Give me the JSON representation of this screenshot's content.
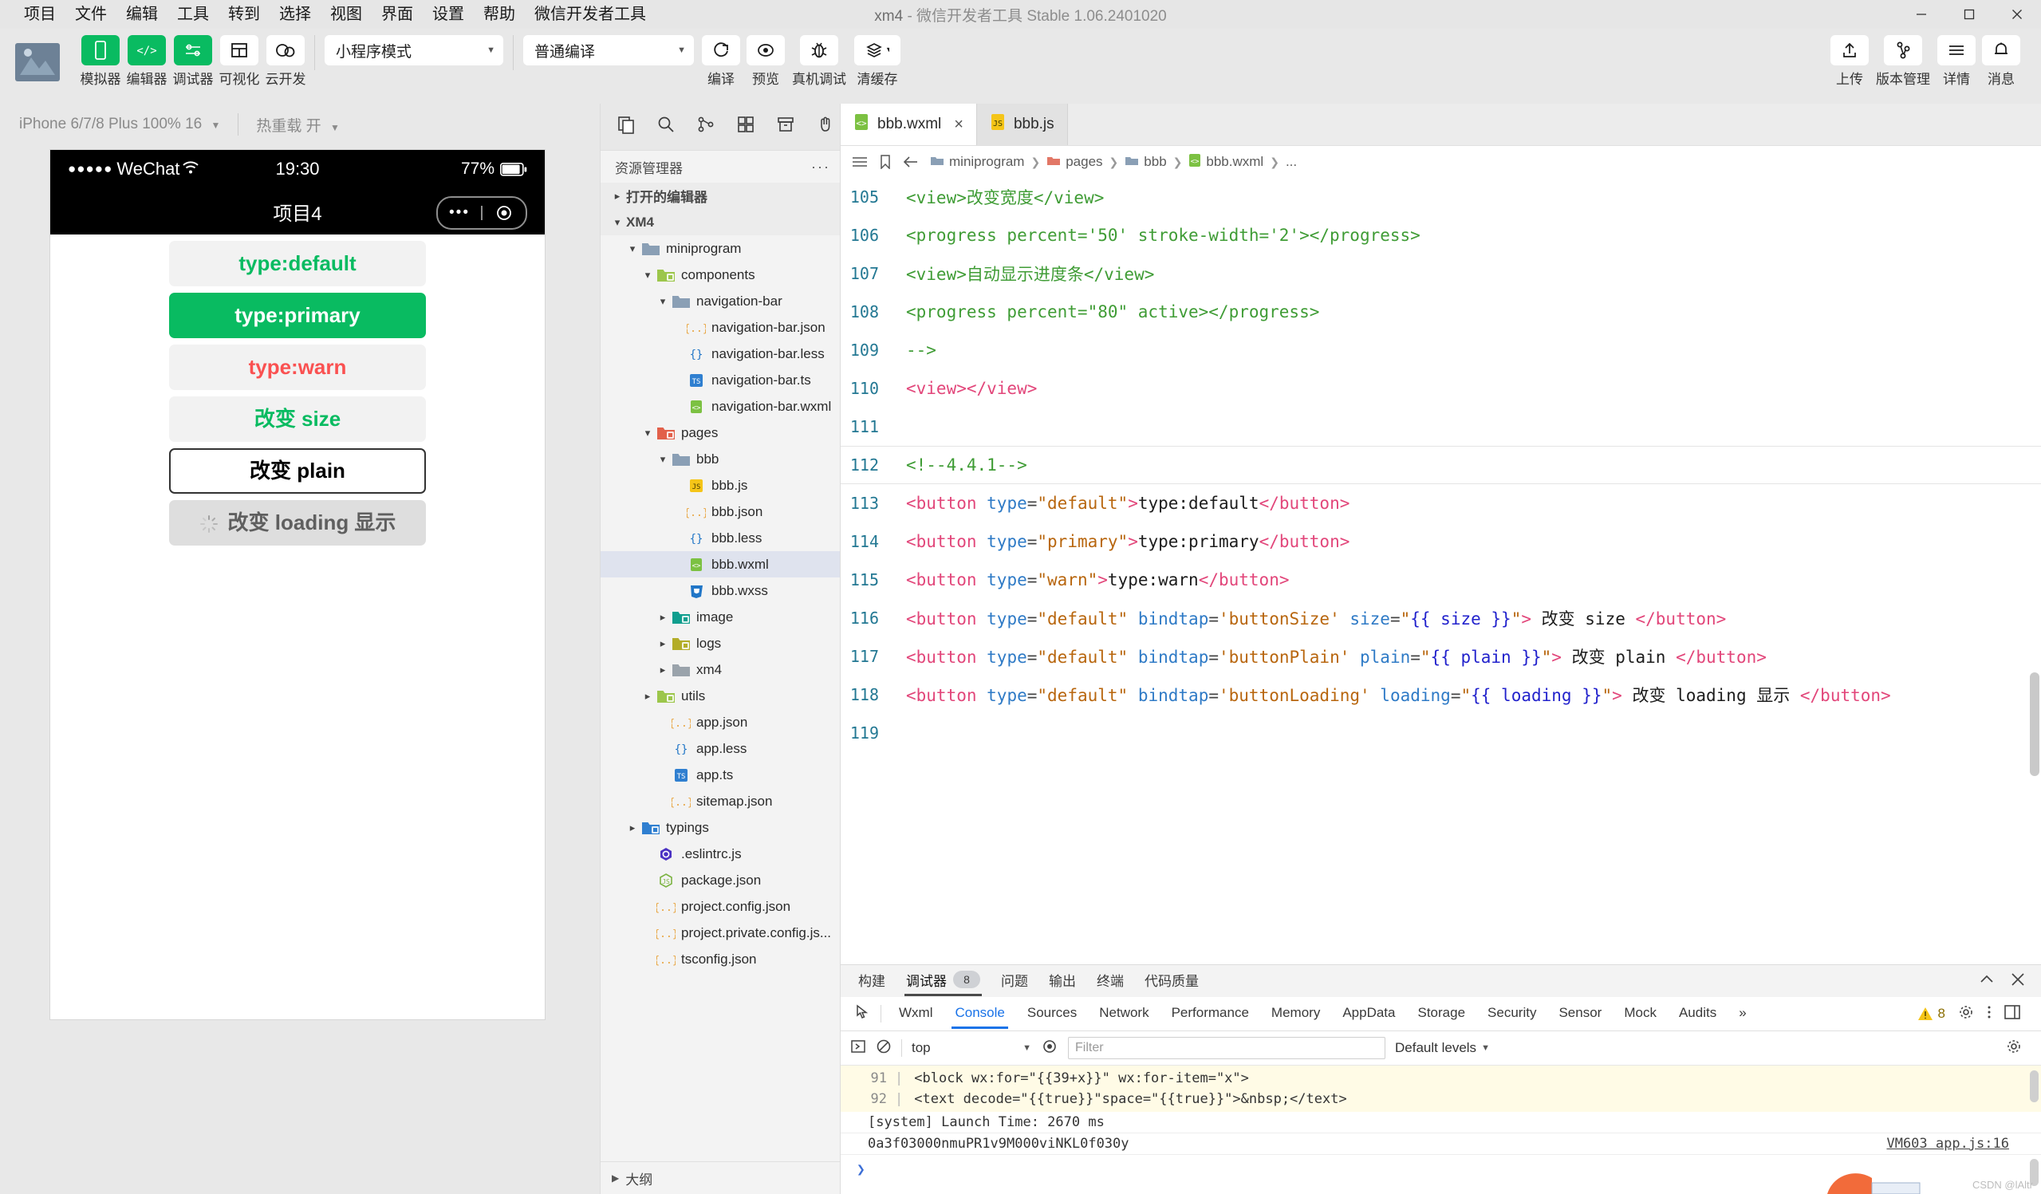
{
  "window": {
    "project": "xm4",
    "dash": "-",
    "app_name": "微信开发者工具",
    "version": "Stable 1.06.2401020",
    "minimize": "minimize-icon",
    "maximize": "maximize-icon",
    "close": "close-icon"
  },
  "menubar": {
    "items": [
      "项目",
      "文件",
      "编辑",
      "工具",
      "转到",
      "选择",
      "视图",
      "界面",
      "设置",
      "帮助",
      "微信开发者工具"
    ]
  },
  "toolbar": {
    "left_buttons": [
      {
        "label": "模拟器",
        "icon": "phone-icon",
        "active": true
      },
      {
        "label": "编辑器",
        "icon": "code-icon",
        "active": true
      },
      {
        "label": "调试器",
        "icon": "debugger-icon",
        "active": true
      },
      {
        "label": "可视化",
        "icon": "layout-icon",
        "active": false
      },
      {
        "label": "云开发",
        "icon": "cloud-icon",
        "active": false
      }
    ],
    "mode_select": "小程序模式",
    "compile_select": "普通编译",
    "action_buttons": [
      {
        "label": "编译",
        "icon": "refresh-icon"
      },
      {
        "label": "预览",
        "icon": "eye-icon"
      },
      {
        "label": "真机调试",
        "icon": "bug-icon"
      },
      {
        "label": "清缓存",
        "icon": "layers-icon"
      }
    ],
    "right_buttons": [
      {
        "label": "上传",
        "icon": "upload-icon"
      },
      {
        "label": "版本管理",
        "icon": "branch-icon"
      },
      {
        "label": "详情",
        "icon": "menu-icon"
      },
      {
        "label": "消息",
        "icon": "bell-icon"
      }
    ]
  },
  "simulator": {
    "device": "iPhone 6/7/8 Plus 100% 16",
    "hot_reload": "热重载 开",
    "status": {
      "dots": "●●●●●",
      "carrier": "WeChat",
      "time": "19:30",
      "battery": "77%"
    },
    "nav_title": "项目4",
    "capsule_dots": "•••",
    "buttons": [
      {
        "label": "type:default",
        "style": "default"
      },
      {
        "label": "type:primary",
        "style": "primary"
      },
      {
        "label": "type:warn",
        "style": "warn"
      },
      {
        "label": "改变 size",
        "style": "default"
      },
      {
        "label": "改变 plain",
        "style": "plain"
      },
      {
        "label": "改变 loading 显示",
        "style": "loading"
      }
    ]
  },
  "explorer": {
    "title": "资源管理器",
    "more": "ellipsis-icon",
    "outline": "大纲",
    "icons": [
      "copy-icon",
      "search-icon",
      "source-control-icon",
      "extensions-icon",
      "archive-icon",
      "hand-icon"
    ],
    "tree": [
      {
        "label": "打开的编辑器",
        "depth": 0,
        "type": "section",
        "arrow": "right"
      },
      {
        "label": "XM4",
        "depth": 0,
        "type": "section",
        "arrow": "down"
      },
      {
        "label": "miniprogram",
        "depth": 1,
        "type": "folder",
        "arrow": "down",
        "icon": "folder-blue"
      },
      {
        "label": "components",
        "depth": 2,
        "type": "folder",
        "arrow": "down",
        "icon": "folder-green"
      },
      {
        "label": "navigation-bar",
        "depth": 3,
        "type": "folder",
        "arrow": "down",
        "icon": "folder-blue"
      },
      {
        "label": "navigation-bar.json",
        "depth": 4,
        "type": "file",
        "icon": "json"
      },
      {
        "label": "navigation-bar.less",
        "depth": 4,
        "type": "file",
        "icon": "less"
      },
      {
        "label": "navigation-bar.ts",
        "depth": 4,
        "type": "file",
        "icon": "ts"
      },
      {
        "label": "navigation-bar.wxml",
        "depth": 4,
        "type": "file",
        "icon": "wxml"
      },
      {
        "label": "pages",
        "depth": 2,
        "type": "folder",
        "arrow": "down",
        "icon": "folder-red"
      },
      {
        "label": "bbb",
        "depth": 3,
        "type": "folder",
        "arrow": "down",
        "icon": "folder-blue"
      },
      {
        "label": "bbb.js",
        "depth": 4,
        "type": "file",
        "icon": "js"
      },
      {
        "label": "bbb.json",
        "depth": 4,
        "type": "file",
        "icon": "json"
      },
      {
        "label": "bbb.less",
        "depth": 4,
        "type": "file",
        "icon": "less"
      },
      {
        "label": "bbb.wxml",
        "depth": 4,
        "type": "file",
        "icon": "wxml",
        "selected": true
      },
      {
        "label": "bbb.wxss",
        "depth": 4,
        "type": "file",
        "icon": "wxss"
      },
      {
        "label": "image",
        "depth": 3,
        "type": "folder",
        "arrow": "right",
        "icon": "folder-teal"
      },
      {
        "label": "logs",
        "depth": 3,
        "type": "folder",
        "arrow": "right",
        "icon": "folder-olive"
      },
      {
        "label": "xm4",
        "depth": 3,
        "type": "folder",
        "arrow": "right",
        "icon": "folder-gray"
      },
      {
        "label": "utils",
        "depth": 2,
        "type": "folder",
        "arrow": "right",
        "icon": "folder-green"
      },
      {
        "label": "app.json",
        "depth": 3,
        "type": "file",
        "icon": "json"
      },
      {
        "label": "app.less",
        "depth": 3,
        "type": "file",
        "icon": "less"
      },
      {
        "label": "app.ts",
        "depth": 3,
        "type": "file",
        "icon": "ts"
      },
      {
        "label": "sitemap.json",
        "depth": 3,
        "type": "file",
        "icon": "json"
      },
      {
        "label": "typings",
        "depth": 1,
        "type": "folder",
        "arrow": "right",
        "icon": "folder-ts"
      },
      {
        "label": ".eslintrc.js",
        "depth": 2,
        "type": "file",
        "icon": "eslint"
      },
      {
        "label": "package.json",
        "depth": 2,
        "type": "file",
        "icon": "npm"
      },
      {
        "label": "project.config.json",
        "depth": 2,
        "type": "file",
        "icon": "json"
      },
      {
        "label": "project.private.config.js...",
        "depth": 2,
        "type": "file",
        "icon": "json"
      },
      {
        "label": "tsconfig.json",
        "depth": 2,
        "type": "file",
        "icon": "json"
      }
    ]
  },
  "editor": {
    "tabs": [
      {
        "label": "bbb.wxml",
        "icon": "wxml",
        "active": true,
        "close": "×"
      },
      {
        "label": "bbb.js",
        "icon": "js",
        "active": false
      }
    ],
    "breadcrumb": [
      "miniprogram",
      "pages",
      "bbb",
      "bbb.wxml",
      "..."
    ],
    "breadcrumb_icons": [
      "list-icon",
      "bookmark-icon",
      "back-arrow-icon"
    ],
    "lines": [
      {
        "num": "105",
        "segments": [
          {
            "t": "<view>",
            "c": "com"
          },
          {
            "t": "改变宽度",
            "c": "com"
          },
          {
            "t": "</view>",
            "c": "com"
          }
        ]
      },
      {
        "num": "106",
        "segments": [
          {
            "t": "<progress percent='50' stroke-width='2'></progress>",
            "c": "com"
          }
        ]
      },
      {
        "num": "107",
        "segments": [
          {
            "t": "<view>自动显示进度条</view>",
            "c": "com"
          }
        ]
      },
      {
        "num": "108",
        "segments": [
          {
            "t": "<progress percent=\"80\" active></progress>",
            "c": "com"
          }
        ]
      },
      {
        "num": "109",
        "segments": [
          {
            "t": "-->",
            "c": "com"
          }
        ]
      },
      {
        "num": "110",
        "segments": [
          {
            "t": "<view>",
            "c": "tag"
          },
          {
            "t": "</view>",
            "c": "tag"
          }
        ]
      },
      {
        "num": "111",
        "segments": []
      },
      {
        "num": "112",
        "hl": true,
        "segments": [
          {
            "t": "<!--4.4.1-->",
            "c": "com"
          }
        ]
      },
      {
        "num": "113",
        "segments": [
          {
            "t": "<button ",
            "c": "tag"
          },
          {
            "t": "type",
            "c": "attr"
          },
          {
            "t": "=",
            "c": "gray"
          },
          {
            "t": "\"default\"",
            "c": "str"
          },
          {
            "t": ">",
            "c": "tag"
          },
          {
            "t": "type:default",
            "c": "txt"
          },
          {
            "t": "</button>",
            "c": "tag"
          }
        ]
      },
      {
        "num": "114",
        "segments": [
          {
            "t": "<button ",
            "c": "tag"
          },
          {
            "t": "type",
            "c": "attr"
          },
          {
            "t": "=",
            "c": "gray"
          },
          {
            "t": "\"primary\"",
            "c": "str"
          },
          {
            "t": ">",
            "c": "tag"
          },
          {
            "t": "type:primary",
            "c": "txt"
          },
          {
            "t": "</button>",
            "c": "tag"
          }
        ]
      },
      {
        "num": "115",
        "segments": [
          {
            "t": "<button ",
            "c": "tag"
          },
          {
            "t": "type",
            "c": "attr"
          },
          {
            "t": "=",
            "c": "gray"
          },
          {
            "t": "\"warn\"",
            "c": "str"
          },
          {
            "t": ">",
            "c": "tag"
          },
          {
            "t": "type:warn",
            "c": "txt"
          },
          {
            "t": "</button>",
            "c": "tag"
          }
        ]
      },
      {
        "num": "116",
        "segments": [
          {
            "t": "<button ",
            "c": "tag"
          },
          {
            "t": "type",
            "c": "attr"
          },
          {
            "t": "=",
            "c": "gray"
          },
          {
            "t": "\"default\"",
            "c": "str"
          },
          {
            "t": " bindtap",
            "c": "attr"
          },
          {
            "t": "=",
            "c": "gray"
          },
          {
            "t": "'buttonSize'",
            "c": "str"
          },
          {
            "t": " size",
            "c": "attr"
          },
          {
            "t": "=",
            "c": "gray"
          },
          {
            "t": "\"",
            "c": "str"
          },
          {
            "t": "{{ size }}",
            "c": "mus"
          },
          {
            "t": "\"",
            "c": "str"
          },
          {
            "t": "> ",
            "c": "tag"
          },
          {
            "t": "改变 size ",
            "c": "txt"
          },
          {
            "t": "</button>",
            "c": "tag"
          }
        ]
      },
      {
        "num": "117",
        "segments": [
          {
            "t": "<button ",
            "c": "tag"
          },
          {
            "t": "type",
            "c": "attr"
          },
          {
            "t": "=",
            "c": "gray"
          },
          {
            "t": "\"default\"",
            "c": "str"
          },
          {
            "t": " bindtap",
            "c": "attr"
          },
          {
            "t": "=",
            "c": "gray"
          },
          {
            "t": "'buttonPlain'",
            "c": "str"
          },
          {
            "t": " plain",
            "c": "attr"
          },
          {
            "t": "=",
            "c": "gray"
          },
          {
            "t": "\"",
            "c": "str"
          },
          {
            "t": "{{ plain }}",
            "c": "mus"
          },
          {
            "t": "\"",
            "c": "str"
          },
          {
            "t": "> ",
            "c": "tag"
          },
          {
            "t": "改变 plain ",
            "c": "txt"
          },
          {
            "t": "</button>",
            "c": "tag"
          }
        ]
      },
      {
        "num": "118",
        "segments": [
          {
            "t": "<button ",
            "c": "tag"
          },
          {
            "t": "type",
            "c": "attr"
          },
          {
            "t": "=",
            "c": "gray"
          },
          {
            "t": "\"default\"",
            "c": "str"
          },
          {
            "t": " bindtap",
            "c": "attr"
          },
          {
            "t": "=",
            "c": "gray"
          },
          {
            "t": "'buttonLoading'",
            "c": "str"
          },
          {
            "t": " loading",
            "c": "attr"
          },
          {
            "t": "=",
            "c": "gray"
          },
          {
            "t": "\"",
            "c": "str"
          },
          {
            "t": "{{ loading }}",
            "c": "mus"
          },
          {
            "t": "\"",
            "c": "str"
          },
          {
            "t": "> ",
            "c": "tag"
          },
          {
            "t": "改变 loading 显示 ",
            "c": "txt"
          },
          {
            "t": "</button>",
            "c": "tag"
          }
        ]
      },
      {
        "num": "119",
        "segments": []
      }
    ]
  },
  "panel": {
    "tabs": [
      {
        "label": "构建",
        "active": false
      },
      {
        "label": "调试器",
        "active": true,
        "badge": "8"
      },
      {
        "label": "问题",
        "active": false
      },
      {
        "label": "输出",
        "active": false
      },
      {
        "label": "终端",
        "active": false
      },
      {
        "label": "代码质量",
        "active": false
      }
    ],
    "collapse": "chevron-up-icon",
    "close": "close-icon",
    "devtools_tabs": [
      {
        "label": "Wxml",
        "active": false
      },
      {
        "label": "Console",
        "active": true
      },
      {
        "label": "Sources",
        "active": false
      },
      {
        "label": "Network",
        "active": false
      },
      {
        "label": "Performance",
        "active": false
      },
      {
        "label": "Memory",
        "active": false
      },
      {
        "label": "AppData",
        "active": false
      },
      {
        "label": "Storage",
        "active": false
      },
      {
        "label": "Security",
        "active": false
      },
      {
        "label": "Sensor",
        "active": false
      },
      {
        "label": "Mock",
        "active": false
      },
      {
        "label": "Audits",
        "active": false
      }
    ],
    "overflow": "»",
    "warning_count": "8",
    "inspect_icon": "inspect-icon",
    "settings_icon": "gear-icon",
    "kebab_icon": "kebab-icon",
    "dock_icon": "dock-icon",
    "filter": {
      "execute_icon": "execute-icon",
      "clear_icon": "clear-icon",
      "context": "top",
      "eye_icon": "eye-icon",
      "placeholder": "Filter",
      "levels": "Default levels",
      "settings_icon": "gear-icon"
    },
    "console_rows": [
      {
        "type": "warn",
        "num": "91",
        "text": "<block wx:for=\"{{39+x}}\" wx:for-item=\"x\">"
      },
      {
        "type": "warn",
        "num": "92",
        "text": "<text decode=\"{{true}}\"space=\"{{true}}\">&nbsp;</text>"
      },
      {
        "type": "log",
        "text": "[system] Launch Time: 2670 ms"
      },
      {
        "type": "log",
        "text": "0a3f03000nmuPR1v9M000viNKL0f030y",
        "link": "VM603 app.js:16"
      }
    ],
    "prompt": "❯",
    "watermark": "CSDN @lAltr"
  }
}
